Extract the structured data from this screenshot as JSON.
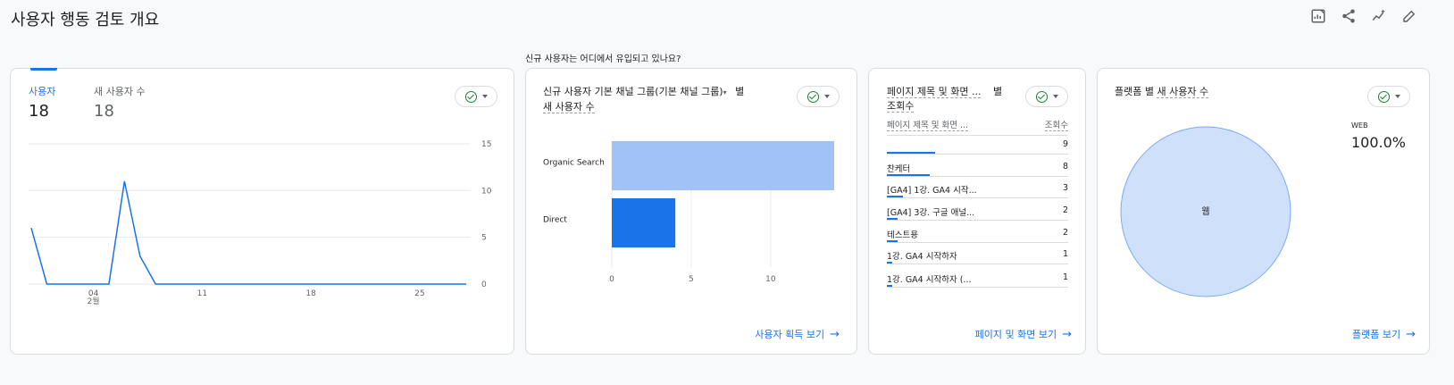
{
  "page": {
    "title": "사용자 행동 검토 개요"
  },
  "top_icons": [
    "customize-report-icon",
    "share-icon",
    "insights-icon",
    "edit-icon"
  ],
  "section_question": "신규 사용자는 어디에서 유입되고 있나요?",
  "card1": {
    "tab1": {
      "label": "사용자",
      "value": "18"
    },
    "tab2": {
      "label": "새 사용자 수",
      "value": "18"
    },
    "chart_data": {
      "type": "line",
      "x": [
        "01-31",
        "02-01",
        "02-02",
        "02-03",
        "02-04",
        "02-05",
        "02-06",
        "02-07",
        "02-08",
        "02-09",
        "02-10",
        "02-11",
        "02-12",
        "02-13",
        "02-14",
        "02-15",
        "02-16",
        "02-17",
        "02-18",
        "02-19",
        "02-20",
        "02-21",
        "02-22",
        "02-23",
        "02-24",
        "02-25",
        "02-26",
        "02-27",
        "02-28"
      ],
      "values": [
        6,
        0,
        0,
        0,
        0,
        0,
        11,
        3,
        0,
        0,
        0,
        0,
        0,
        0,
        0,
        0,
        0,
        0,
        0,
        0,
        0,
        0,
        0,
        0,
        0,
        0,
        0,
        0,
        0
      ],
      "ylim": [
        0,
        15
      ],
      "y_ticks": [
        "15",
        "10",
        "5",
        "0"
      ],
      "x_ticks": [
        "04",
        "11",
        "18",
        "25"
      ],
      "x_month": "2월",
      "color": "#1a73e8",
      "grid": true
    }
  },
  "card2": {
    "title": "신규 사용자 기본 채널 그룹(기본 채널 그룹)",
    "title_suffix": "별",
    "metric": "새 사용자 수",
    "chart_data": {
      "type": "bar",
      "categories": [
        "Organic Search",
        "Direct"
      ],
      "values": [
        14,
        4
      ],
      "colors": [
        "#a1c2f4",
        "#1a73e8"
      ],
      "xlim": [
        0,
        14
      ],
      "x_ticks": [
        "0",
        "5",
        "10"
      ],
      "grid": true
    },
    "link": "사용자 획득 보기"
  },
  "card3": {
    "title": "페이지 제목 및 화면 ...",
    "title_suffix": "별",
    "metric": "조회수",
    "col_dim": "페이지 제목 및 화면 ...",
    "col_metric": "조회수",
    "rows": [
      {
        "label": "",
        "value": "9",
        "fraction": 1.0
      },
      {
        "label": "찬케터",
        "value": "8",
        "fraction": 0.89
      },
      {
        "label": "[GA4] 1강. GA4 시작...",
        "value": "3",
        "fraction": 0.33
      },
      {
        "label": "[GA4] 3강. 구글 애널...",
        "value": "2",
        "fraction": 0.22
      },
      {
        "label": "테스트용",
        "value": "2",
        "fraction": 0.22
      },
      {
        "label": "1강. GA4 시작하자",
        "value": "1",
        "fraction": 0.11
      },
      {
        "label": "1강. GA4 시작하자 (...",
        "value": "1",
        "fraction": 0.11
      }
    ],
    "link": "페이지 및 화면 보기"
  },
  "card4": {
    "title": "플랫폼 별",
    "metric": "새 사용자 수",
    "legend_label": "WEB",
    "legend_value": "100.0%",
    "chart_data": {
      "type": "pie",
      "categories": [
        "웹"
      ],
      "values": [
        100
      ],
      "colors": [
        "#cfe0fb"
      ]
    },
    "link": "플랫폼 보기"
  }
}
